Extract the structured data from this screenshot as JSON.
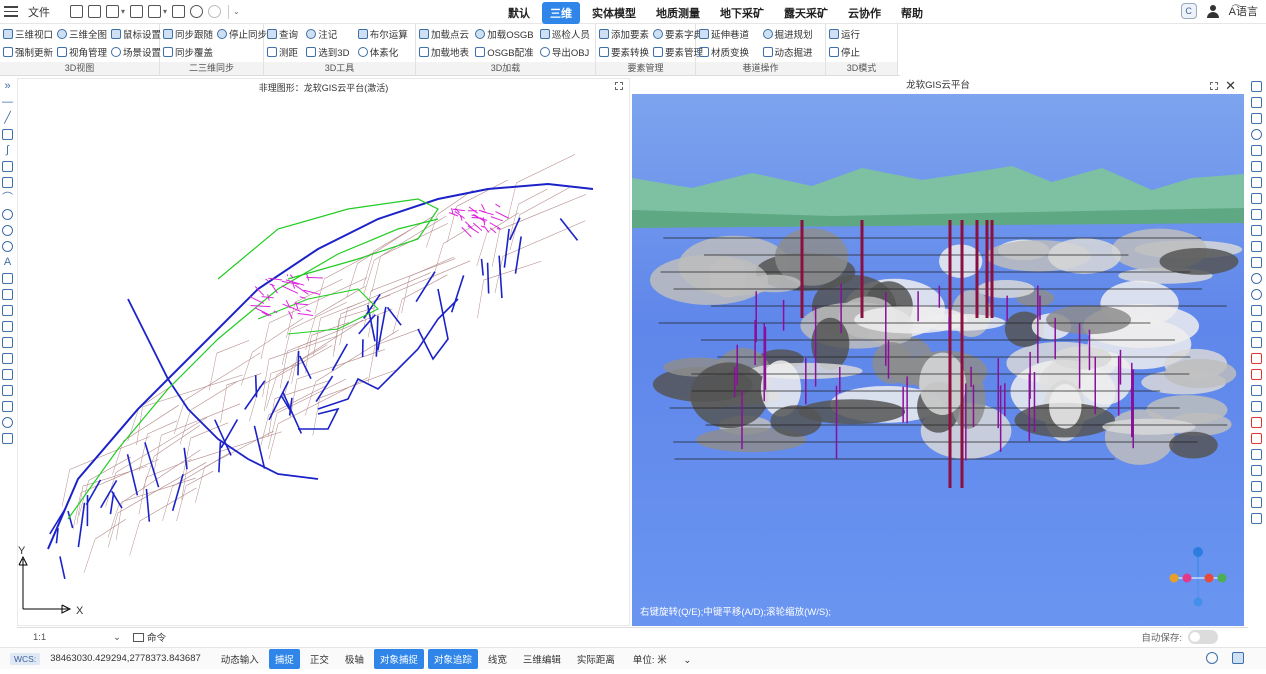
{
  "topbar": {
    "file": "文件",
    "tabs": [
      "默认",
      "三维",
      "实体模型",
      "地质测量",
      "地下采矿",
      "露天采矿",
      "云协作",
      "帮助"
    ],
    "active_tab": "三维",
    "avatar": "C",
    "language": "语言"
  },
  "ribbon": {
    "groups": [
      {
        "title": "3D视图",
        "items": [
          "三维视口",
          "强制更新",
          "三维全图",
          "视角管理",
          "鼠标设置",
          "场景设置"
        ]
      },
      {
        "title": "二三维同步",
        "items": [
          "同步跟随",
          "同步覆盖",
          "停止同步"
        ]
      },
      {
        "title": "3D工具",
        "items": [
          "查询",
          "测距",
          "注记",
          "选到3D",
          "布尔运算",
          "体素化"
        ]
      },
      {
        "title": "3D加载",
        "items": [
          "加载点云",
          "加载地表",
          "加载OSGB",
          "OSGB配准",
          "巡检人员",
          "导出OBJ"
        ]
      },
      {
        "title": "要素管理",
        "items": [
          "添加要素",
          "要素转换",
          "要素字典",
          "要素管理"
        ]
      },
      {
        "title": "巷道操作",
        "items": [
          "延伸巷道",
          "材质变换",
          "掘进规划",
          "动态掘进"
        ]
      },
      {
        "title": "3D模式",
        "items": [
          "运行",
          "停止"
        ]
      }
    ]
  },
  "view2d": {
    "title": "非理图形：龙软GIS云平台(激活)",
    "axis_y": "Y",
    "axis_x": "X"
  },
  "view3d": {
    "title": "龙软GIS云平台",
    "close": "✕",
    "hint": "右键旋转(Q/E);中键平移(A/D);滚轮缩放(W/S);"
  },
  "cmdbar": {
    "scale": "1:1",
    "command_label": "命令",
    "autosave_label": "自动保存:"
  },
  "statusbar": {
    "wcs": "WCS:",
    "coords": "38463030.429294,2778373.843687",
    "buttons": [
      {
        "label": "动态输入",
        "on": false
      },
      {
        "label": "捕捉",
        "on": true
      },
      {
        "label": "正交",
        "on": false
      },
      {
        "label": "极轴",
        "on": false
      },
      {
        "label": "对象捕捉",
        "on": true
      },
      {
        "label": "对象追踪",
        "on": true
      },
      {
        "label": "线宽",
        "on": false
      },
      {
        "label": "三维编辑",
        "on": false
      },
      {
        "label": "实际距离",
        "on": false
      }
    ],
    "units": "单位: 米"
  },
  "colors": {
    "accent": "#2f86e8",
    "tunnel_blue": "#1a22c8",
    "tunnel_green": "#22cc22",
    "tunnel_magenta": "#dd22dd",
    "mine_brown": "#b48a8a",
    "shaft_red": "#8b1040",
    "shaft_purple": "#8a0f9a"
  }
}
